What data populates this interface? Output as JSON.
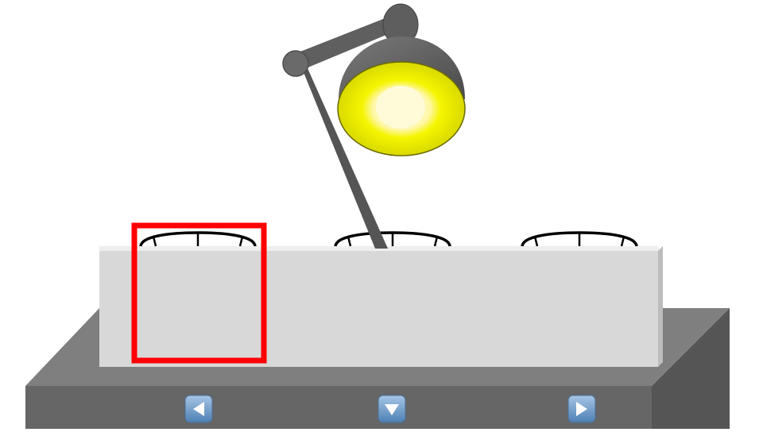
{
  "scene": {
    "lamp": {
      "state": "on",
      "color": "#f5f500",
      "glow": "#fffbd0"
    },
    "slots": [
      {
        "id": 1,
        "selected": true
      },
      {
        "id": 2,
        "selected": false
      },
      {
        "id": 3,
        "selected": false
      }
    ],
    "selection_color": "#ff0000"
  },
  "controls": {
    "left": {
      "icon": "arrow-left-icon"
    },
    "down": {
      "icon": "arrow-down-icon"
    },
    "right": {
      "icon": "arrow-right-icon"
    }
  }
}
